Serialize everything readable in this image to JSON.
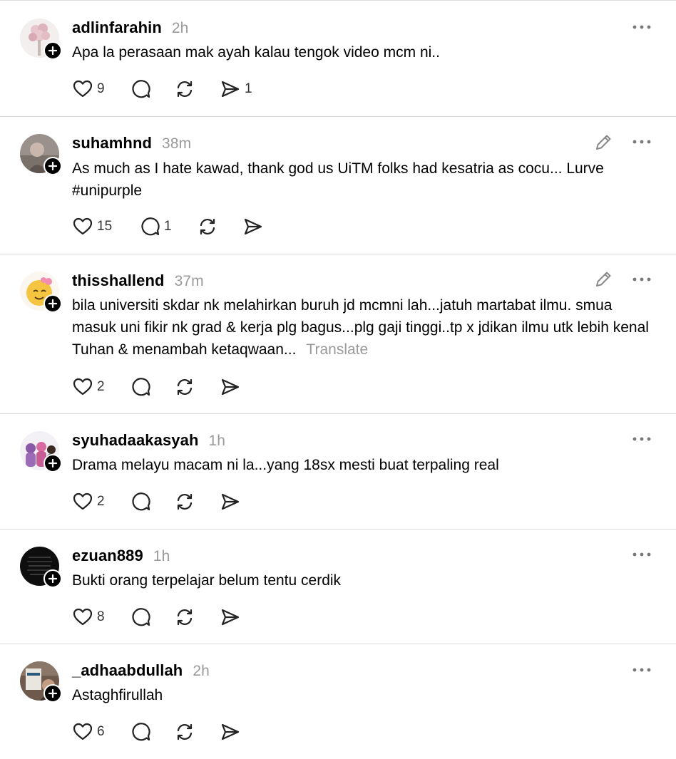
{
  "posts": [
    {
      "username": "adlinfarahin",
      "time": "2h",
      "text": "Apa la perasaan mak ayah kalau tengok video mcm ni..",
      "translate": "",
      "likes": "9",
      "replies": "",
      "reposts": "",
      "shares": "1",
      "editable": false
    },
    {
      "username": "suhamhnd",
      "time": "38m",
      "text": "As much as I hate kawad, thank god us UiTM folks had kesatria as cocu... Lurve #unipurple",
      "translate": "",
      "likes": "15",
      "replies": "1",
      "reposts": "",
      "shares": "",
      "editable": true
    },
    {
      "username": "thisshallend",
      "time": "37m",
      "text": "bila universiti skdar nk melahirkan buruh jd mcmni lah...jatuh martabat ilmu. smua masuk uni fikir nk grad & kerja plg bagus...plg gaji tinggi..tp x jdikan ilmu utk lebih kenal Tuhan & menambah ketaqwaan...",
      "translate": "Translate",
      "likes": "2",
      "replies": "",
      "reposts": "",
      "shares": "",
      "editable": true
    },
    {
      "username": "syuhadaakasyah",
      "time": "1h",
      "text": "Drama melayu macam ni la...yang 18sx mesti buat terpaling real",
      "translate": "",
      "likes": "2",
      "replies": "",
      "reposts": "",
      "shares": "",
      "editable": false
    },
    {
      "username": "ezuan889",
      "time": "1h",
      "text": "Bukti orang terpelajar belum tentu cerdik",
      "translate": "",
      "likes": "8",
      "replies": "",
      "reposts": "",
      "shares": "",
      "editable": false
    },
    {
      "username": "_adhaabdullah",
      "time": "2h",
      "text": "Astaghfirullah",
      "translate": "",
      "likes": "6",
      "replies": "",
      "reposts": "",
      "shares": "",
      "editable": false
    }
  ]
}
